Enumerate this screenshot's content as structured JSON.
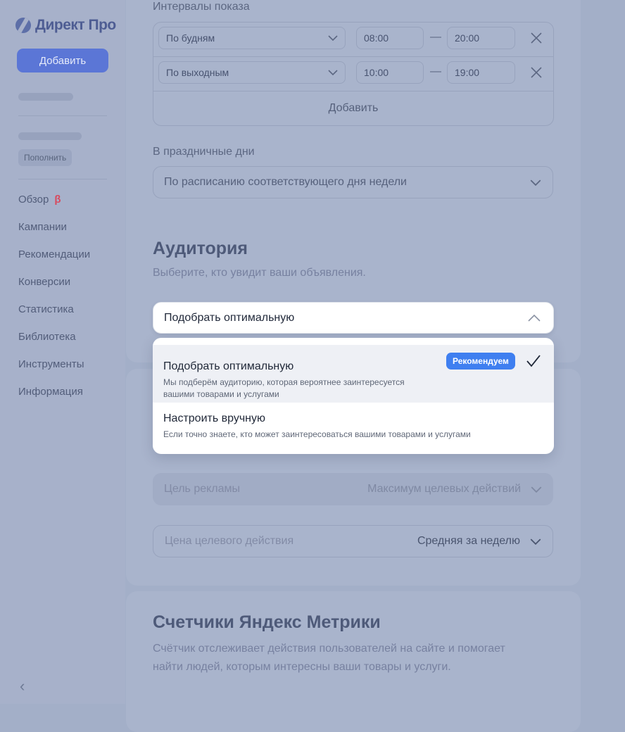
{
  "sidebar": {
    "logo_text": "Директ Про",
    "add_label": "Добавить",
    "topup_label": "Пополнить",
    "beta_mark": "β",
    "items": [
      {
        "label": "Обзор"
      },
      {
        "label": "Кампании"
      },
      {
        "label": "Рекомендации"
      },
      {
        "label": "Конверсии"
      },
      {
        "label": "Статистика"
      },
      {
        "label": "Библиотека"
      },
      {
        "label": "Инструменты"
      },
      {
        "label": "Информация"
      }
    ]
  },
  "schedule": {
    "title": "Интервалы показа",
    "rows": [
      {
        "day": "По будням",
        "from": "08:00",
        "to": "20:00"
      },
      {
        "day": "По выходным",
        "from": "10:00",
        "to": "19:00"
      }
    ],
    "separator": "—",
    "add_label": "Добавить",
    "holidays_label": "В праздничные дни",
    "holidays_value": "По расписанию соответствующего дня недели"
  },
  "audience": {
    "title": "Аудитория",
    "subtitle": "Выберите, кто увидит ваши объявления.",
    "selected": "Подобрать оптимальную",
    "options": [
      {
        "title": "Подобрать оптимальную",
        "desc_line1": "Мы подберём аудиторию, которая вероятнее заинтересуется",
        "desc_line2": "вашими товарами и услугами",
        "badge": "Рекомендуем"
      },
      {
        "title": "Настроить вручную",
        "desc": "Если точно знаете, кто может заинтересоваться вашими товарами и услугами"
      }
    ]
  },
  "strategy": {
    "goal_label": "Цель рекламы",
    "goal_value": "Максимум целевых действий",
    "price_label": "Цена целевого действия",
    "price_value": "Средняя за неделю"
  },
  "metrika": {
    "title": "Счетчики Яндекс Метрики",
    "desc_line1": "Счётчик отслеживает действия пользователей на сайте и помогает",
    "desc_line2": "найти людей, которым интересны ваши товары и услуги."
  },
  "colors": {
    "accent": "#3f7ff0",
    "sidebar_button": "#5b76d6",
    "beta": "#d84a5e"
  }
}
